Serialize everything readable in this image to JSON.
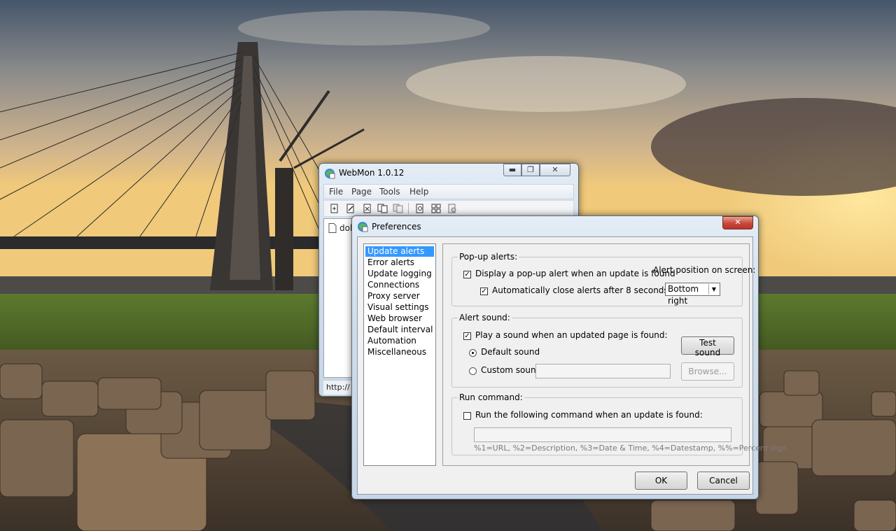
{
  "webmon": {
    "title": "WebMon 1.0.12",
    "menu": [
      "File",
      "Page",
      "Tools",
      "Help"
    ],
    "list_first_item": "dob",
    "status": "http://"
  },
  "prefs": {
    "title": "Preferences",
    "nav": [
      "Update alerts",
      "Error alerts",
      "Update logging",
      "Connections",
      "Proxy server",
      "Visual settings",
      "Web browser",
      "Default interval",
      "Automation",
      "Miscellaneous"
    ],
    "selected_nav": "Update alerts",
    "popup": {
      "legend": "Pop-up alerts:",
      "display_label": "Display a pop-up alert when an update is found",
      "display_checked": true,
      "autoclose_label": "Automatically close alerts after 8 seconds",
      "autoclose_checked": true,
      "position_label": "Alert position on screen:",
      "position_value": "Bottom right"
    },
    "sound": {
      "legend": "Alert sound:",
      "play_label": "Play a sound when an updated page is found:",
      "play_checked": true,
      "default_label": "Default sound",
      "custom_label": "Custom sound:",
      "selected": "Default sound",
      "test_button": "Test sound",
      "browse_button": "Browse..."
    },
    "command": {
      "legend": "Run command:",
      "run_label": "Run the following command when an update is found:",
      "run_checked": false,
      "hint": "%1=URL, %2=Description, %3=Date & Time, %4=Datestamp, %%=Percent sign"
    },
    "ok_button": "OK",
    "cancel_button": "Cancel"
  },
  "colors": {
    "selection": "#3399ff",
    "close_button": "#c7463a"
  }
}
